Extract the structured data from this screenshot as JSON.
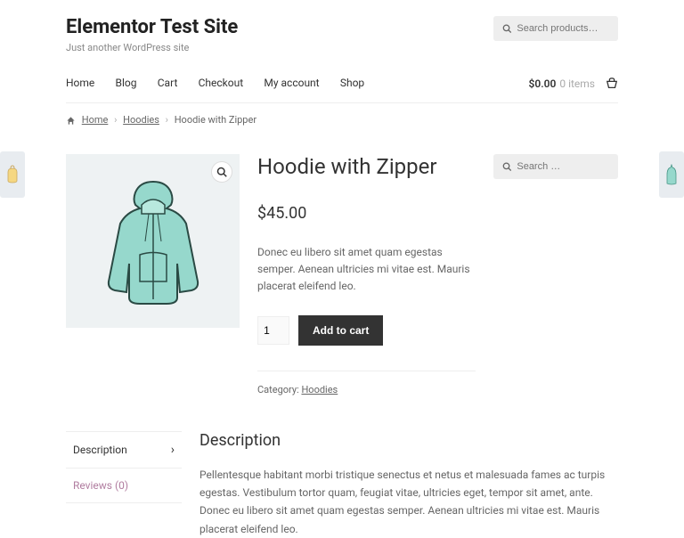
{
  "site": {
    "title": "Elementor Test Site",
    "tagline": "Just another WordPress site"
  },
  "search": {
    "placeholder": "Search products…"
  },
  "nav": {
    "home": "Home",
    "blog": "Blog",
    "cart": "Cart",
    "checkout": "Checkout",
    "account": "My account",
    "shop": "Shop"
  },
  "minicart": {
    "total": "$0.00",
    "items": "0 items"
  },
  "breadcrumb": {
    "home": "Home",
    "cat": "Hoodies",
    "current": "Hoodie with Zipper",
    "sep": "›"
  },
  "product": {
    "title": "Hoodie with Zipper",
    "price": "$45.00",
    "short": "Donec eu libero sit amet quam egestas semper. Aenean ultricies mi vitae est. Mauris placerat eleifend leo.",
    "qty": "1",
    "add": "Add to cart",
    "cat_label": "Category: ",
    "cat_link": "Hoodies"
  },
  "sidebar_search": {
    "placeholder": "Search …"
  },
  "tabs": {
    "desc_label": "Description",
    "reviews_label": "Reviews (0)",
    "heading": "Description",
    "body": "Pellentesque habitant morbi tristique senectus et netus et malesuada fames ac turpis egestas. Vestibulum tortor quam, feugiat vitae, ultricies eget, tempor sit amet, ante. Donec eu libero sit amet quam egestas semper. Aenean ultricies mi vitae est. Mauris placerat eleifend leo."
  }
}
